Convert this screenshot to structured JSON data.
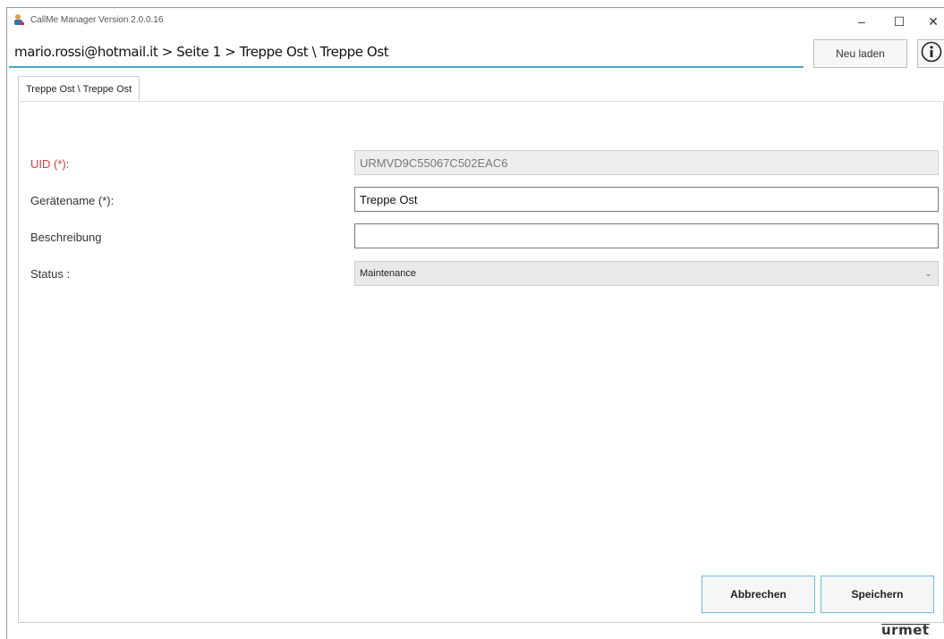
{
  "window": {
    "title": "CallMe Manager Version 2.0.0.16",
    "controls": {
      "minimize": "–",
      "maximize": "☐",
      "close": "✕"
    }
  },
  "header": {
    "breadcrumb": "mario.rossi@hotmail.it > Seite 1 > Treppe Ost \\ Treppe Ost",
    "reload_label": "Neu laden",
    "info_icon": "info-icon"
  },
  "tabs": [
    {
      "label": "Treppe Ost \\ Treppe Ost",
      "active": true
    }
  ],
  "form": {
    "uid_label": "UID (*):",
    "uid_value": "URMVD9C55067C502EAC6",
    "name_label": "Gerätename (*):",
    "name_value": "Treppe Ost",
    "description_label": "Beschreibung",
    "description_value": "",
    "status_label": "Status :",
    "status_value": "Maintenance"
  },
  "actions": {
    "cancel_label": "Abbrechen",
    "save_label": "Speichern"
  },
  "brand": {
    "logo_text": "urmet",
    "accent_color": "#4aa6c7",
    "required_color": "#d53b3b"
  }
}
